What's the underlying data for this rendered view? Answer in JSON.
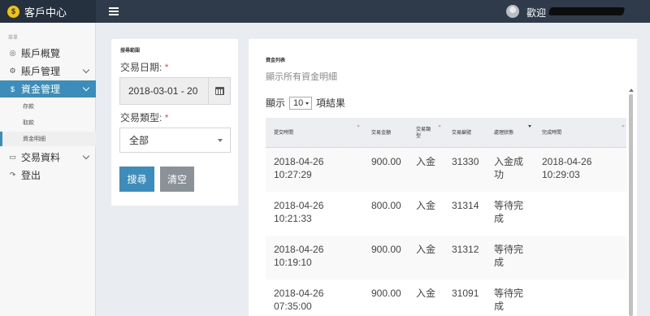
{
  "app": {
    "logo_glyph": "$",
    "name": "客戶中心"
  },
  "header": {
    "welcome": "歡迎"
  },
  "sidebar": {
    "section_label": "菜單",
    "items": [
      {
        "label": "賬戶概覽",
        "icon": "dashboard-icon",
        "glyph": "◎"
      },
      {
        "label": "賬戶管理",
        "icon": "gear-icon",
        "glyph": "⚙"
      },
      {
        "label": "資金管理",
        "icon": "dollar-icon",
        "glyph": "$"
      },
      {
        "label": "交易資料",
        "icon": "briefcase-icon",
        "glyph": "▭"
      },
      {
        "label": "登出",
        "icon": "logout-icon",
        "glyph": "↷"
      }
    ],
    "sub_items": [
      "存款",
      "取款",
      "資金明細"
    ]
  },
  "search": {
    "caption": "搜尋範圍",
    "date_label": "交易日期:",
    "date_value": "2018-03-01 - 20",
    "type_label": "交易類型:",
    "type_value": "全部",
    "required_mark": "*",
    "search_button": "搜尋",
    "clear_button": "清空"
  },
  "funds": {
    "title": "資金列表",
    "subtitle": "顯示所有資金明細",
    "show_prefix": "顯示",
    "page_size": "10",
    "show_suffix": "項結果",
    "columns": [
      "提交時間",
      "交易金額",
      "交易類型",
      "交易編號",
      "處理狀態",
      "完成時間"
    ],
    "rows": [
      {
        "submit_date": "2018-04-26",
        "submit_time": "10:27:29",
        "amount": "900.00",
        "type": "入金",
        "id": "31330",
        "status_l1": "入金成",
        "status_l2": "功",
        "done_date": "2018-04-26",
        "done_time": "10:29:03"
      },
      {
        "submit_date": "2018-04-26",
        "submit_time": "10:21:33",
        "amount": "800.00",
        "type": "入金",
        "id": "31314",
        "status_l1": "等待完",
        "status_l2": "成",
        "done_date": "",
        "done_time": ""
      },
      {
        "submit_date": "2018-04-26",
        "submit_time": "10:19:10",
        "amount": "900.00",
        "type": "入金",
        "id": "31312",
        "status_l1": "等待完",
        "status_l2": "成",
        "done_date": "",
        "done_time": ""
      },
      {
        "submit_date": "2018-04-26",
        "submit_time": "07:35:00",
        "amount": "900.00",
        "type": "入金",
        "id": "31091",
        "status_l1": "等待完",
        "status_l2": "成",
        "done_date": "",
        "done_time": ""
      }
    ]
  },
  "colors": {
    "topbar": "#2f3b4b",
    "brand_bg": "#26313f",
    "accent": "#3c8dbc",
    "clear_button": "#8a9199",
    "required": "#d9534f"
  }
}
